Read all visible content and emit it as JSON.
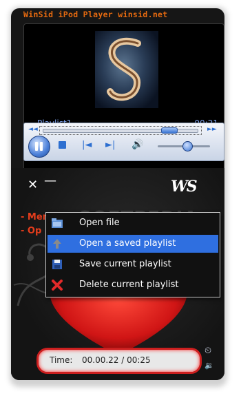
{
  "window": {
    "title": "WinSid iPod Player winsid.net"
  },
  "now_playing": {
    "playlist_name": "Playlist1",
    "time": "00:21",
    "seek_position": 0.83,
    "volume": 0.55
  },
  "controls": {
    "rewind": "◄◄",
    "fast_forward": "►►",
    "prev": "|◄",
    "next": "►|",
    "speaker": "🔊"
  },
  "topbar": {
    "close": "✕",
    "minimize": "—",
    "logo": "WS"
  },
  "side_menu": {
    "items": [
      "- Menu",
      "- Op"
    ]
  },
  "watermark": "SOFTPEDIA",
  "context_menu": {
    "items": [
      {
        "label": "Open file",
        "icon": "folder-icon",
        "highlighted": false
      },
      {
        "label": "Open a saved playlist",
        "icon": "open-playlist-icon",
        "highlighted": true
      },
      {
        "label": "Save current playlist",
        "icon": "save-icon",
        "highlighted": false
      },
      {
        "label": "Delete current playlist",
        "icon": "delete-icon",
        "highlighted": false
      }
    ]
  },
  "status": {
    "time_label": "Time:",
    "time_value": "00.00.22 / 00:25"
  },
  "colors": {
    "title": "#e66a10",
    "accent": "#2f6fe0",
    "menu_red": "#e53d1c",
    "heart": "#d01515",
    "pill_border": "#cc1f1f"
  }
}
